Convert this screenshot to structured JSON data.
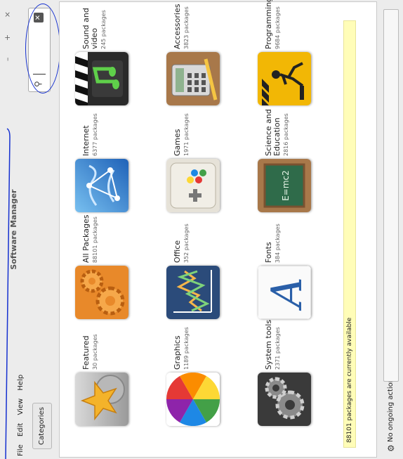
{
  "window": {
    "title": "Software Manager",
    "controls": [
      "–",
      "+",
      "×"
    ]
  },
  "menu": {
    "file": "File",
    "edit": "Edit",
    "view": "View",
    "help": "Help"
  },
  "toolbar": {
    "categories_label": "Categories"
  },
  "search": {
    "value": "",
    "placeholder": ""
  },
  "categories": [
    {
      "name": "Featured",
      "count": "30 packages",
      "icon": "star-icon"
    },
    {
      "name": "All Packages",
      "count": "88101 packages",
      "icon": "gears-icon"
    },
    {
      "name": "Internet",
      "count": "6377 packages",
      "icon": "globe-icon"
    },
    {
      "name": "Sound and video",
      "count": "245 packages",
      "icon": "media-icon"
    },
    {
      "name": "Graphics",
      "count": "1189 packages",
      "icon": "color-wheel-icon"
    },
    {
      "name": "Office",
      "count": "352 packages",
      "icon": "chart-icon"
    },
    {
      "name": "Games",
      "count": "1971 packages",
      "icon": "gamepad-icon"
    },
    {
      "name": "Accessories",
      "count": "3823 packages",
      "icon": "calculator-icon"
    },
    {
      "name": "System tools",
      "count": "2371 packages",
      "icon": "system-gears-icon"
    },
    {
      "name": "Fonts",
      "count": "384 packages",
      "icon": "font-icon"
    },
    {
      "name": "Science and Education",
      "count": "2816 packages",
      "icon": "chalkboard-icon"
    },
    {
      "name": "Programming",
      "count": "9684 packages",
      "icon": "construction-icon"
    }
  ],
  "status": {
    "message": "88101 packages are currently available"
  },
  "bottom": {
    "actions": "No ongoing actions"
  }
}
